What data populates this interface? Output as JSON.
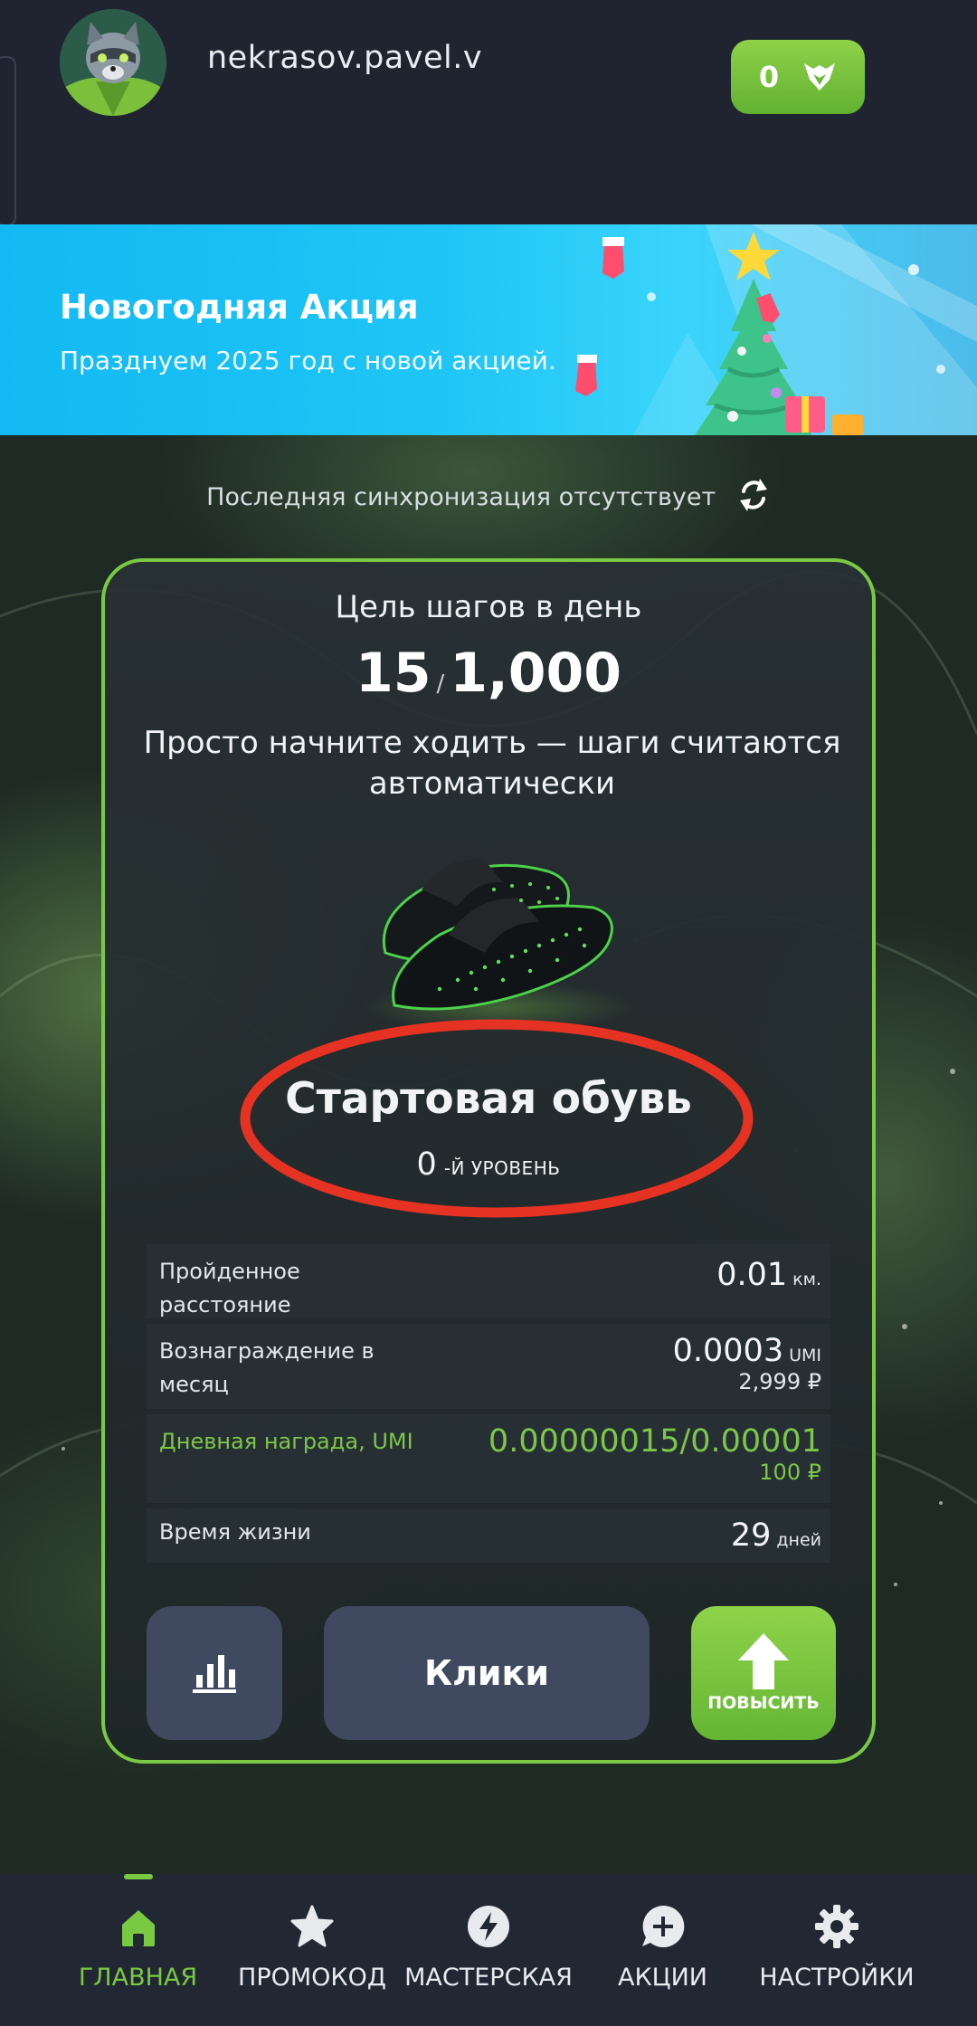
{
  "header": {
    "username": "nekrasov.pavel.v",
    "balance": "0"
  },
  "banner": {
    "title": "Новогодняя Акция",
    "subtitle": "Празднуем 2025 год с новой акцией."
  },
  "sync": {
    "text": "Последняя синхронизация отсутствует"
  },
  "card": {
    "goal_label": "Цель шагов в день",
    "steps_current": "15",
    "steps_goal": "1,000",
    "hint": "Просто начните ходить — шаги считаются автоматически",
    "shoe_name": "Стартовая обувь",
    "level_num": "0",
    "level_suffix": "-Й УРОВЕНЬ",
    "stats": [
      {
        "label": "Пройденное расстояние",
        "value": "0.01",
        "unit": "км.",
        "rub": ""
      },
      {
        "label": "Вознаграждение в месяц",
        "value": "0.0003",
        "unit": "UMI",
        "rub": "2,999 ₽"
      },
      {
        "label": "Дневная награда, UMI",
        "value": "0.00000015/0.00001",
        "unit": "",
        "rub": "100 ₽"
      },
      {
        "label": "Время жизни",
        "value": "29",
        "unit": "дней",
        "rub": ""
      }
    ],
    "clicks_label": "Клики",
    "upgrade_label": "ПОВЫСИТЬ"
  },
  "nav": {
    "items": [
      {
        "label": "ГЛАВНАЯ",
        "icon": "home-icon",
        "active": true
      },
      {
        "label": "ПРОМОКОД",
        "icon": "star-icon",
        "active": false
      },
      {
        "label": "МАСТЕРСКАЯ",
        "icon": "bolt-icon",
        "active": false
      },
      {
        "label": "АКЦИИ",
        "icon": "chat-plus-icon",
        "active": false
      },
      {
        "label": "НАСТРОЙКИ",
        "icon": "gear-icon",
        "active": false
      }
    ]
  },
  "colors": {
    "accent": "#7ac943",
    "background": "#1f2430",
    "highlight": "#e53222"
  }
}
